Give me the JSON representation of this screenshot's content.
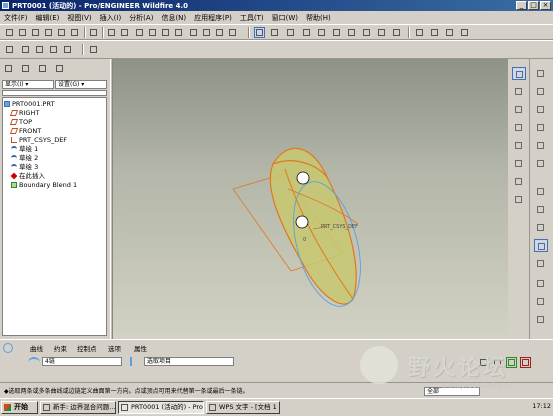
{
  "window": {
    "title": "PRT0001 (活动的) - Pro/ENGINEER Wildfire 4.0"
  },
  "menubar": [
    "文件(F)",
    "编辑(E)",
    "视图(V)",
    "插入(I)",
    "分析(A)",
    "信息(N)",
    "应用程序(P)",
    "工具(T)",
    "窗口(W)",
    "帮助(H)"
  ],
  "model_tree": {
    "display_menu": "显示(I) ▾",
    "settings_menu": "设置(G) ▾",
    "items": [
      {
        "label": "PRT0001.PRT",
        "icon": "part-icon",
        "color": "#3b6fc4"
      },
      {
        "label": "RIGHT",
        "icon": "datum-plane-icon",
        "color": "#c05020"
      },
      {
        "label": "TOP",
        "icon": "datum-plane-icon",
        "color": "#c05020"
      },
      {
        "label": "FRONT",
        "icon": "datum-plane-icon",
        "color": "#c05020"
      },
      {
        "label": "PRT_CSYS_DEF",
        "icon": "csys-icon",
        "color": "#c05020"
      },
      {
        "label": "草绘 1",
        "icon": "sketch-icon",
        "color": "#3060b0"
      },
      {
        "label": "草绘 2",
        "icon": "sketch-icon",
        "color": "#3060b0"
      },
      {
        "label": "草绘 3",
        "icon": "sketch-icon",
        "color": "#3060b0"
      },
      {
        "label": "在此插入",
        "icon": "insert-here-icon",
        "color": "#cc0000"
      },
      {
        "label": "Boundary Blend 1",
        "icon": "boundary-blend-icon",
        "color": "#2a8a2a"
      }
    ]
  },
  "graphics": {
    "csys_label": "PRT_CSYS_DEF",
    "point_label": "0",
    "surface_color": "#c8c870",
    "edge_color": "#e07820",
    "curve_color": "#5aa0e0"
  },
  "dashboard": {
    "tabs": [
      "曲线",
      "约束",
      "控制点",
      "选项",
      "属性"
    ],
    "field_1": "4链",
    "field_2": "选取项目",
    "message": "◆选取两条或多条曲线或边链定义曲面第一方向。点或顶点可用来代替第一条或最后一条链。",
    "filter": "全部"
  },
  "taskbar": {
    "start": "开始",
    "tasks": [
      {
        "label": "新手: 边界混合问题..."
      },
      {
        "label": "PRT0001 (活动的) - Pro/..."
      },
      {
        "label": "WPS 文字 - [文档 1 *]"
      }
    ],
    "clock": "17:12"
  },
  "watermark": {
    "text": "野火论坛",
    "url": "www.proewildfire.cn"
  }
}
